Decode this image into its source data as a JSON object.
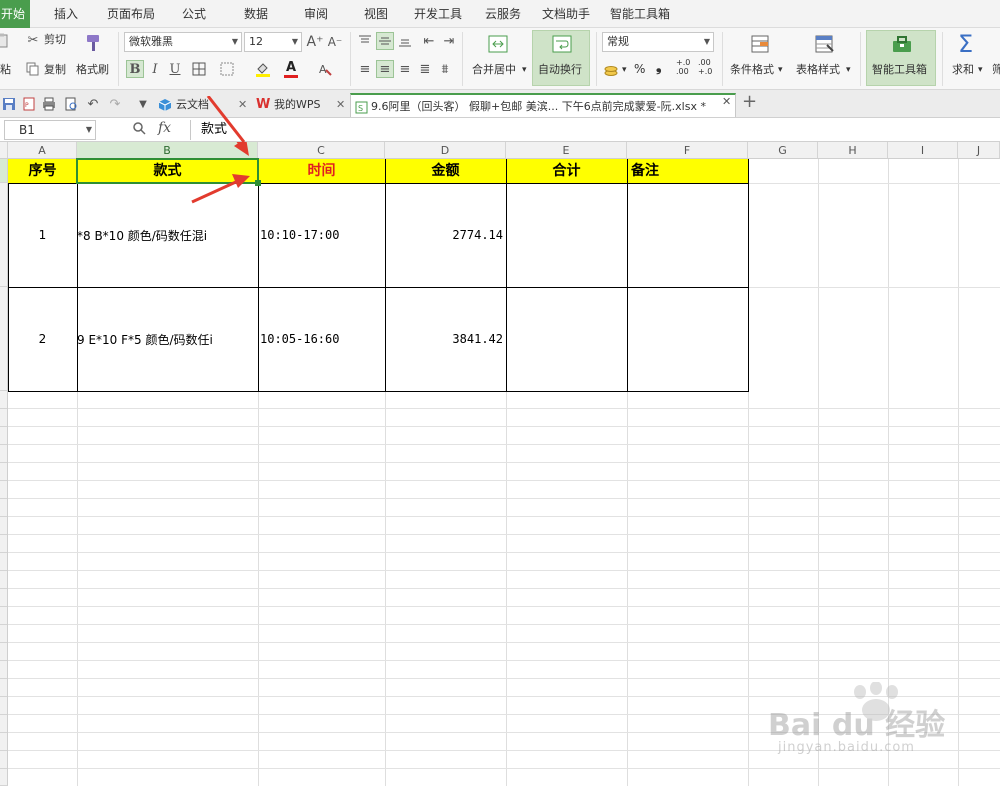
{
  "menu": {
    "tabs": [
      "开始",
      "插入",
      "页面布局",
      "公式",
      "数据",
      "审阅",
      "视图",
      "开发工具",
      "云服务",
      "文档助手",
      "智能工具箱"
    ],
    "active": "开始"
  },
  "ribbon": {
    "cut": "剪切",
    "paste_partial": "粘",
    "copy": "复制",
    "format_painter": "格式刷",
    "font_name": "微软雅黑",
    "font_size": "12",
    "bold": "B",
    "italic": "I",
    "underline": "U",
    "font_color_glyph": "A",
    "merge_center": "合并居中",
    "wrap_text": "自动换行",
    "number_format": "常规",
    "percent": "%",
    "thousands": "⁹",
    "inc_decimal": "+.0\n.00",
    "dec_decimal": ".00\n+.0",
    "conditional_format": "条件格式",
    "table_style": "表格样式",
    "smart_toolbox": "智能工具箱",
    "sum": "求和",
    "sigma": "Σ",
    "filter_partial": "筛"
  },
  "tabs": {
    "cloud_doc": "云文档",
    "my_wps": "我的WPS",
    "file": "9.6阿里（回头客） 假聊+包邮 美滨... 下午6点前完成蒙爱-阮.xlsx *"
  },
  "formula_bar": {
    "name_box": "B1",
    "fx": "fx",
    "content": "款式"
  },
  "columns": [
    "A",
    "B",
    "C",
    "D",
    "E",
    "F",
    "G",
    "H",
    "I",
    "J"
  ],
  "header_row": {
    "a": "序号",
    "b": "款式",
    "c": "时间",
    "d": "金额",
    "e": "合计",
    "f": "备注"
  },
  "rows": [
    {
      "no": "1",
      "style": "*8  B*10  颜色/码数任混i",
      "time": "10:10-17:00",
      "amount": "2774.14"
    },
    {
      "no": "2",
      "style": "9 E*10 F*5  颜色/码数任i",
      "time": "10:05-16:60",
      "amount": "3841.42"
    }
  ],
  "watermark": {
    "brand": "Bai du 经验",
    "url": "jingyan.baidu.com"
  },
  "colors": {
    "accent_green": "#4a9d4d",
    "header_fill": "#ffff00",
    "time_header_text": "#e02020",
    "arrow_red": "#e23b2e"
  }
}
